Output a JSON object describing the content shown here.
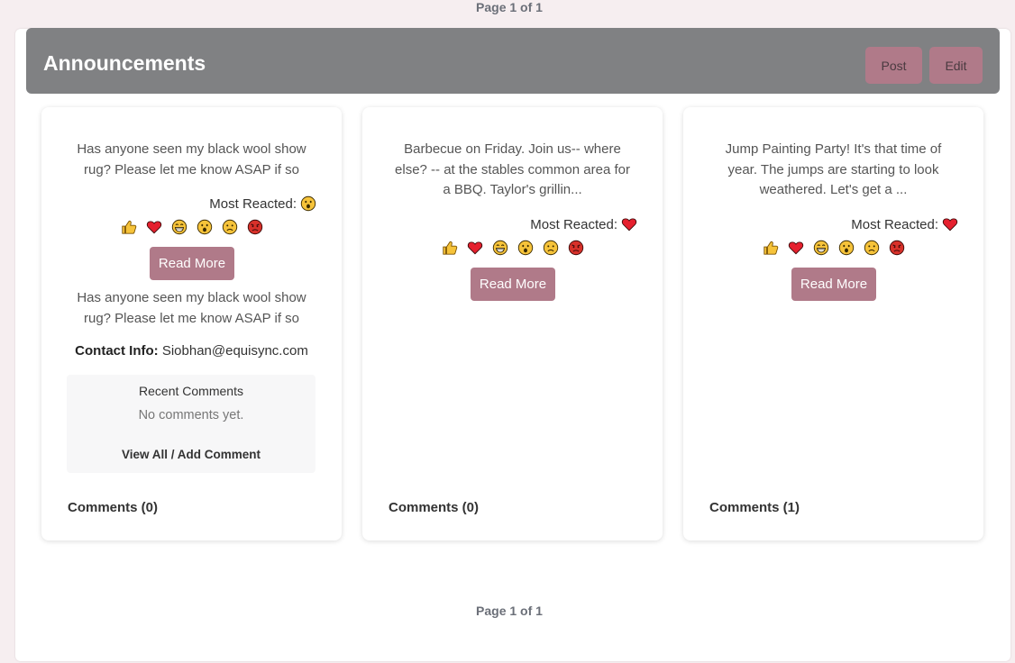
{
  "pagination_top": "Page 1 of 1",
  "pagination_bottom": "Page 1 of 1",
  "header": {
    "title": "Announcements",
    "post_label": "Post",
    "edit_label": "Edit"
  },
  "reaction_icons": [
    "thumbs-up-icon",
    "heart-icon",
    "laughing-icon",
    "surprised-icon",
    "sad-icon",
    "angry-icon"
  ],
  "colors": {
    "header_bg": "#808183",
    "accent": "#b07a89",
    "heart": "#e5202e",
    "emoji_yellow": "#f6c33a"
  },
  "cards": [
    {
      "excerpt": "Has anyone seen my black wool show rug? Please let me know ASAP if so",
      "most_reacted_label": "Most Reacted:",
      "most_reacted_icon": "surprised-icon",
      "read_more_label": "Read More",
      "full_text": "Has anyone seen my black wool show rug? Please let me know ASAP if so",
      "contact_label": "Contact Info:",
      "contact_value": "Siobhan@equisync.com",
      "recent_comments_title": "Recent Comments",
      "no_comments_text": "No comments yet.",
      "view_all_label": "View All / Add Comment",
      "comments_count_label": "Comments (0)"
    },
    {
      "excerpt": "Barbecue on Friday. Join us-- where else? -- at the stables common area for a BBQ. Taylor's grillin...",
      "most_reacted_label": "Most Reacted:",
      "most_reacted_icon": "heart-icon",
      "read_more_label": "Read More",
      "comments_count_label": "Comments (0)"
    },
    {
      "excerpt": "Jump Painting Party! It's that time of year. The jumps are starting to look weathered. Let's get a ...",
      "most_reacted_label": "Most Reacted:",
      "most_reacted_icon": "heart-icon",
      "read_more_label": "Read More",
      "comments_count_label": "Comments (1)"
    }
  ]
}
